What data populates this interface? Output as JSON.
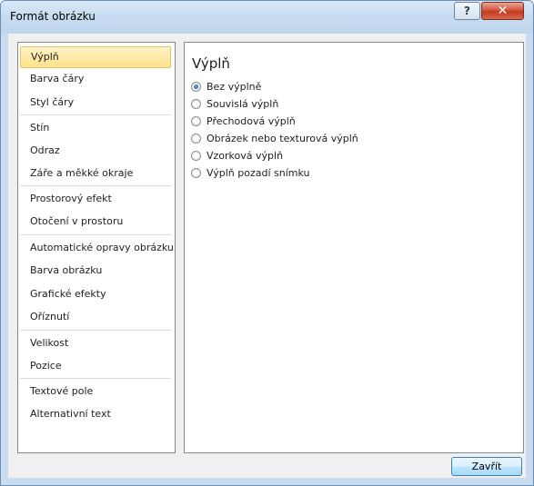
{
  "window": {
    "title": "Formát obrázku",
    "help_glyph": "?",
    "close_glyph": "✕"
  },
  "nav": {
    "items": [
      {
        "label": "Výplň",
        "selected": true
      },
      {
        "label": "Barva čáry"
      },
      {
        "label": "Styl čáry"
      },
      {
        "label": "Stín"
      },
      {
        "label": "Odraz"
      },
      {
        "label": "Záře a měkké okraje"
      },
      {
        "label": "Prostorový efekt"
      },
      {
        "label": "Otočení v prostoru"
      },
      {
        "label": "Automatické opravy obrázku"
      },
      {
        "label": "Barva obrázku"
      },
      {
        "label": "Grafické efekty"
      },
      {
        "label": "Oříznutí"
      },
      {
        "label": "Velikost"
      },
      {
        "label": "Pozice"
      },
      {
        "label": "Textové pole"
      },
      {
        "label": "Alternativní text"
      }
    ]
  },
  "content": {
    "title": "Výplň",
    "options": [
      {
        "label": "Bez výplně",
        "checked": true
      },
      {
        "label": "Souvislá výplň"
      },
      {
        "label": "Přechodová výplň"
      },
      {
        "label": "Obrázek nebo texturová výplň"
      },
      {
        "label": "Vzorková výplň"
      },
      {
        "label": "Výplň pozadí snímku"
      }
    ]
  },
  "footer": {
    "close_label": "Zavřít"
  },
  "colors": {
    "selection_bg": "#fde18a",
    "frame": "#c9dcef",
    "close_button": "#c2381f"
  }
}
